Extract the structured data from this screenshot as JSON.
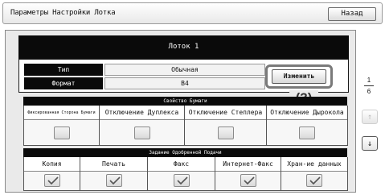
{
  "window": {
    "title": "Параметры Настройки Лотка",
    "back_label": "Назад"
  },
  "tray": {
    "name": "Лоток 1"
  },
  "info": {
    "type_label": "Тип",
    "type_value": "Обычная",
    "size_label": "Формат",
    "size_value": "B4"
  },
  "change_button": {
    "label": "Изменить"
  },
  "callout": "(3)",
  "paper_properties": {
    "title": "Свойство Бумаги",
    "items": [
      {
        "label": "Фиксированная Сторона Бумаги",
        "checked": false
      },
      {
        "label": "Отключение Дуплекса",
        "checked": false
      },
      {
        "label": "Отключение Степлера",
        "checked": false
      },
      {
        "label": "Отключение Дырокола",
        "checked": false
      }
    ]
  },
  "feed_modes": {
    "title": "Задание Одобренной Подачи",
    "items": [
      {
        "label": "Копия",
        "checked": true
      },
      {
        "label": "Печать",
        "checked": true
      },
      {
        "label": "Факс",
        "checked": true
      },
      {
        "label": "Интернет-Факс",
        "checked": true
      },
      {
        "label": "Хран-ие данных",
        "checked": true
      }
    ]
  },
  "pager": {
    "current": "1",
    "total": "6"
  }
}
